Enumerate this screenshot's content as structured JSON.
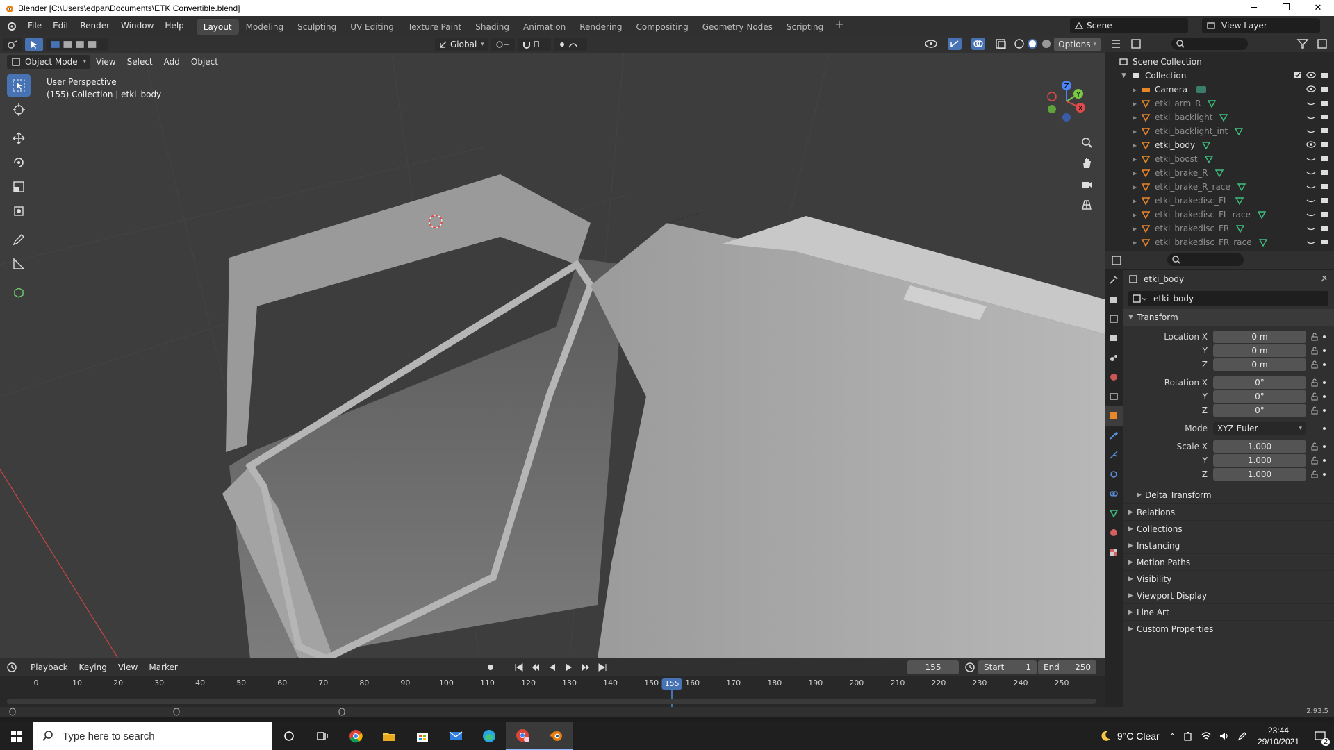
{
  "window": {
    "title": "Blender [C:\\Users\\edpar\\Documents\\ETK Convertible.blend]",
    "min": "─",
    "max": "❐",
    "close": "✕"
  },
  "topbar": {
    "menus": [
      "File",
      "Edit",
      "Render",
      "Window",
      "Help"
    ],
    "workspaces": [
      "Layout",
      "Modeling",
      "Sculpting",
      "UV Editing",
      "Texture Paint",
      "Shading",
      "Animation",
      "Rendering",
      "Compositing",
      "Geometry Nodes",
      "Scripting"
    ],
    "active_workspace": "Layout",
    "add_tab": "+",
    "scene": "Scene",
    "view_layer": "View Layer"
  },
  "viewport": {
    "mode": "Object Mode",
    "menus": [
      "View",
      "Select",
      "Add",
      "Object"
    ],
    "orientation": "Global",
    "options": "Options",
    "perspective": "User Perspective",
    "collection_info": "(155) Collection | etki_body"
  },
  "outliner": {
    "root": "Scene Collection",
    "collection": "Collection",
    "items": [
      {
        "name": "Camera",
        "dim": false
      },
      {
        "name": "etki_arm_R",
        "dim": true
      },
      {
        "name": "etki_backlight",
        "dim": true
      },
      {
        "name": "etki_backlight_int",
        "dim": true
      },
      {
        "name": "etki_body",
        "dim": false
      },
      {
        "name": "etki_boost",
        "dim": true
      },
      {
        "name": "etki_brake_R",
        "dim": true
      },
      {
        "name": "etki_brake_R_race",
        "dim": true
      },
      {
        "name": "etki_brakedisc_FL",
        "dim": true
      },
      {
        "name": "etki_brakedisc_FL_race",
        "dim": true
      },
      {
        "name": "etki_brakedisc_FR",
        "dim": true
      },
      {
        "name": "etki_brakedisc_FR_race",
        "dim": true
      }
    ]
  },
  "properties": {
    "object_name": "etki_body",
    "data_name": "etki_body",
    "transform_label": "Transform",
    "location": {
      "label_x": "Location X",
      "label_y": "Y",
      "label_z": "Z",
      "x": "0 m",
      "y": "0 m",
      "z": "0 m"
    },
    "rotation": {
      "label_x": "Rotation X",
      "label_y": "Y",
      "label_z": "Z",
      "x": "0°",
      "y": "0°",
      "z": "0°"
    },
    "mode": {
      "label": "Mode",
      "value": "XYZ Euler"
    },
    "scale": {
      "label_x": "Scale X",
      "label_y": "Y",
      "label_z": "Z",
      "x": "1.000",
      "y": "1.000",
      "z": "1.000"
    },
    "delta_transform": "Delta Transform",
    "panels": [
      "Relations",
      "Collections",
      "Instancing",
      "Motion Paths",
      "Visibility",
      "Viewport Display",
      "Line Art",
      "Custom Properties"
    ]
  },
  "timeline": {
    "menus": [
      "Playback",
      "Keying",
      "View",
      "Marker"
    ],
    "current_frame": "155",
    "start_label": "Start",
    "start": "1",
    "end_label": "End",
    "end": "250",
    "ticks": [
      "0",
      "10",
      "20",
      "30",
      "40",
      "50",
      "60",
      "70",
      "80",
      "90",
      "100",
      "110",
      "120",
      "130",
      "140",
      "150",
      "155",
      "160",
      "170",
      "180",
      "190",
      "200",
      "210",
      "220",
      "230",
      "240",
      "250"
    ]
  },
  "status": {
    "version": "2.93.5"
  },
  "taskbar": {
    "search_placeholder": "Type here to search",
    "weather": "9°C  Clear",
    "time": "23:44",
    "date": "29/10/2021",
    "notifications": "2"
  }
}
